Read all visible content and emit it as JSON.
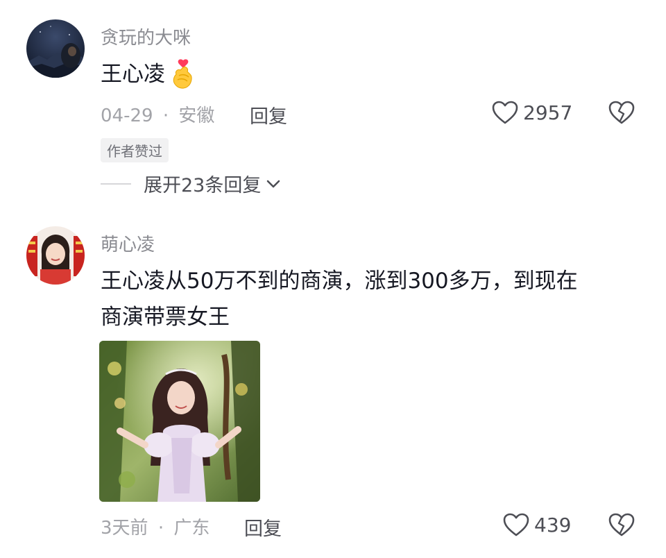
{
  "comments": [
    {
      "username": "贪玩的大咪",
      "text": "王心凌",
      "emoji_icon": "finger-heart-icon",
      "date": "04-29",
      "separator": "·",
      "location": "安徽",
      "reply_label": "回复",
      "likes": "2957",
      "badge": "作者赞过",
      "expand_label": "展开23条回复",
      "avatar_icon": "night-sky-avatar"
    },
    {
      "username": "萌心凌",
      "text_line1": "王心凌从50万不到的商演，涨到300多万，到现在",
      "text_line2": "商演带票女王",
      "date": "3天前",
      "separator": "·",
      "location": "广东",
      "reply_label": "回复",
      "likes": "439",
      "avatar_icon": "girl-portrait-avatar",
      "image_icon": "performer-in-garden-photo"
    }
  ],
  "colors": {
    "background": "#ffffff",
    "text_primary": "#161823",
    "text_secondary": "#8a8b91",
    "text_meta": "#a2a3a8",
    "badge_bg": "#f1f1f2"
  }
}
